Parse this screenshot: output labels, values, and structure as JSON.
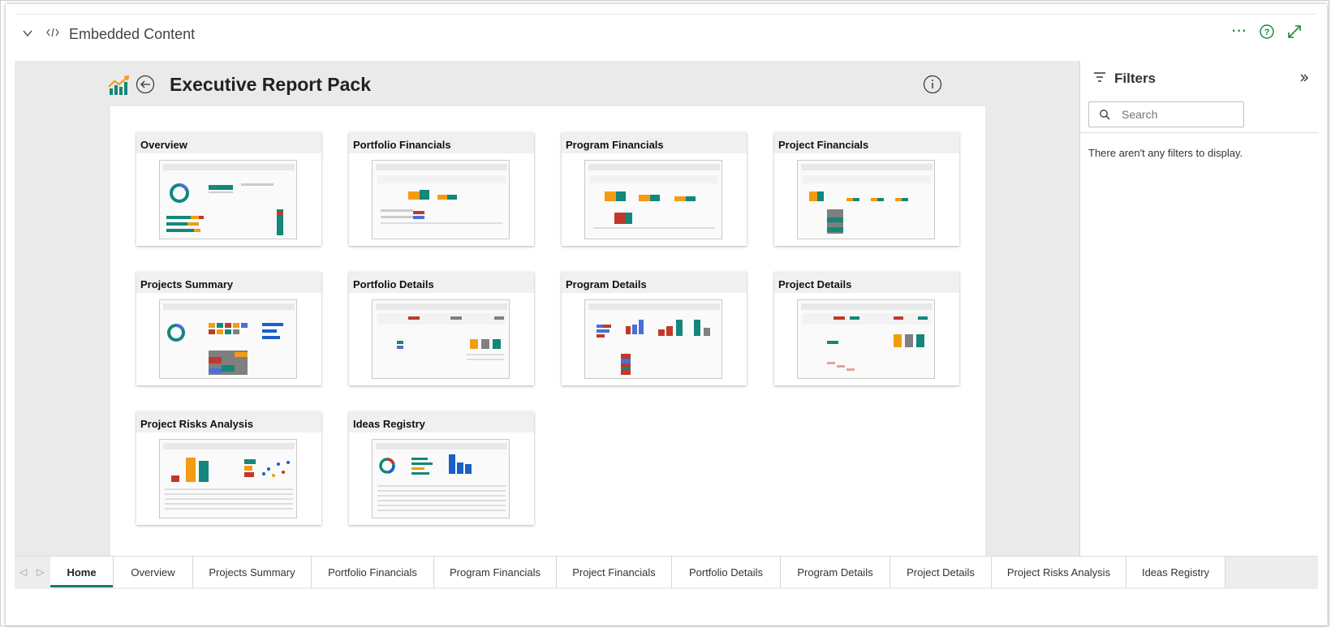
{
  "header": {
    "title": "Embedded Content",
    "more_label": "···"
  },
  "report": {
    "title": "Executive Report Pack"
  },
  "cards": [
    {
      "title": "Overview"
    },
    {
      "title": "Portfolio Financials"
    },
    {
      "title": "Program Financials"
    },
    {
      "title": "Project Financials"
    },
    {
      "title": "Projects Summary"
    },
    {
      "title": "Portfolio Details"
    },
    {
      "title": "Program Details"
    },
    {
      "title": "Project Details"
    },
    {
      "title": "Project Risks Analysis"
    },
    {
      "title": "Ideas Registry"
    }
  ],
  "filters": {
    "title": "Filters",
    "search_placeholder": "Search",
    "empty_message": "There aren't any filters to display."
  },
  "tabs": [
    {
      "label": "Home",
      "active": true
    },
    {
      "label": "Overview"
    },
    {
      "label": "Projects Summary"
    },
    {
      "label": "Portfolio Financials"
    },
    {
      "label": "Program Financials"
    },
    {
      "label": "Project Financials"
    },
    {
      "label": "Portfolio Details"
    },
    {
      "label": "Program Details"
    },
    {
      "label": "Project Details"
    },
    {
      "label": "Project Risks Analysis"
    },
    {
      "label": "Ideas Registry"
    }
  ],
  "colors": {
    "accent_green": "#1a8a3a",
    "tab_underline": "#1a7a6a",
    "teal": "#13877a",
    "orange": "#f39c12"
  }
}
